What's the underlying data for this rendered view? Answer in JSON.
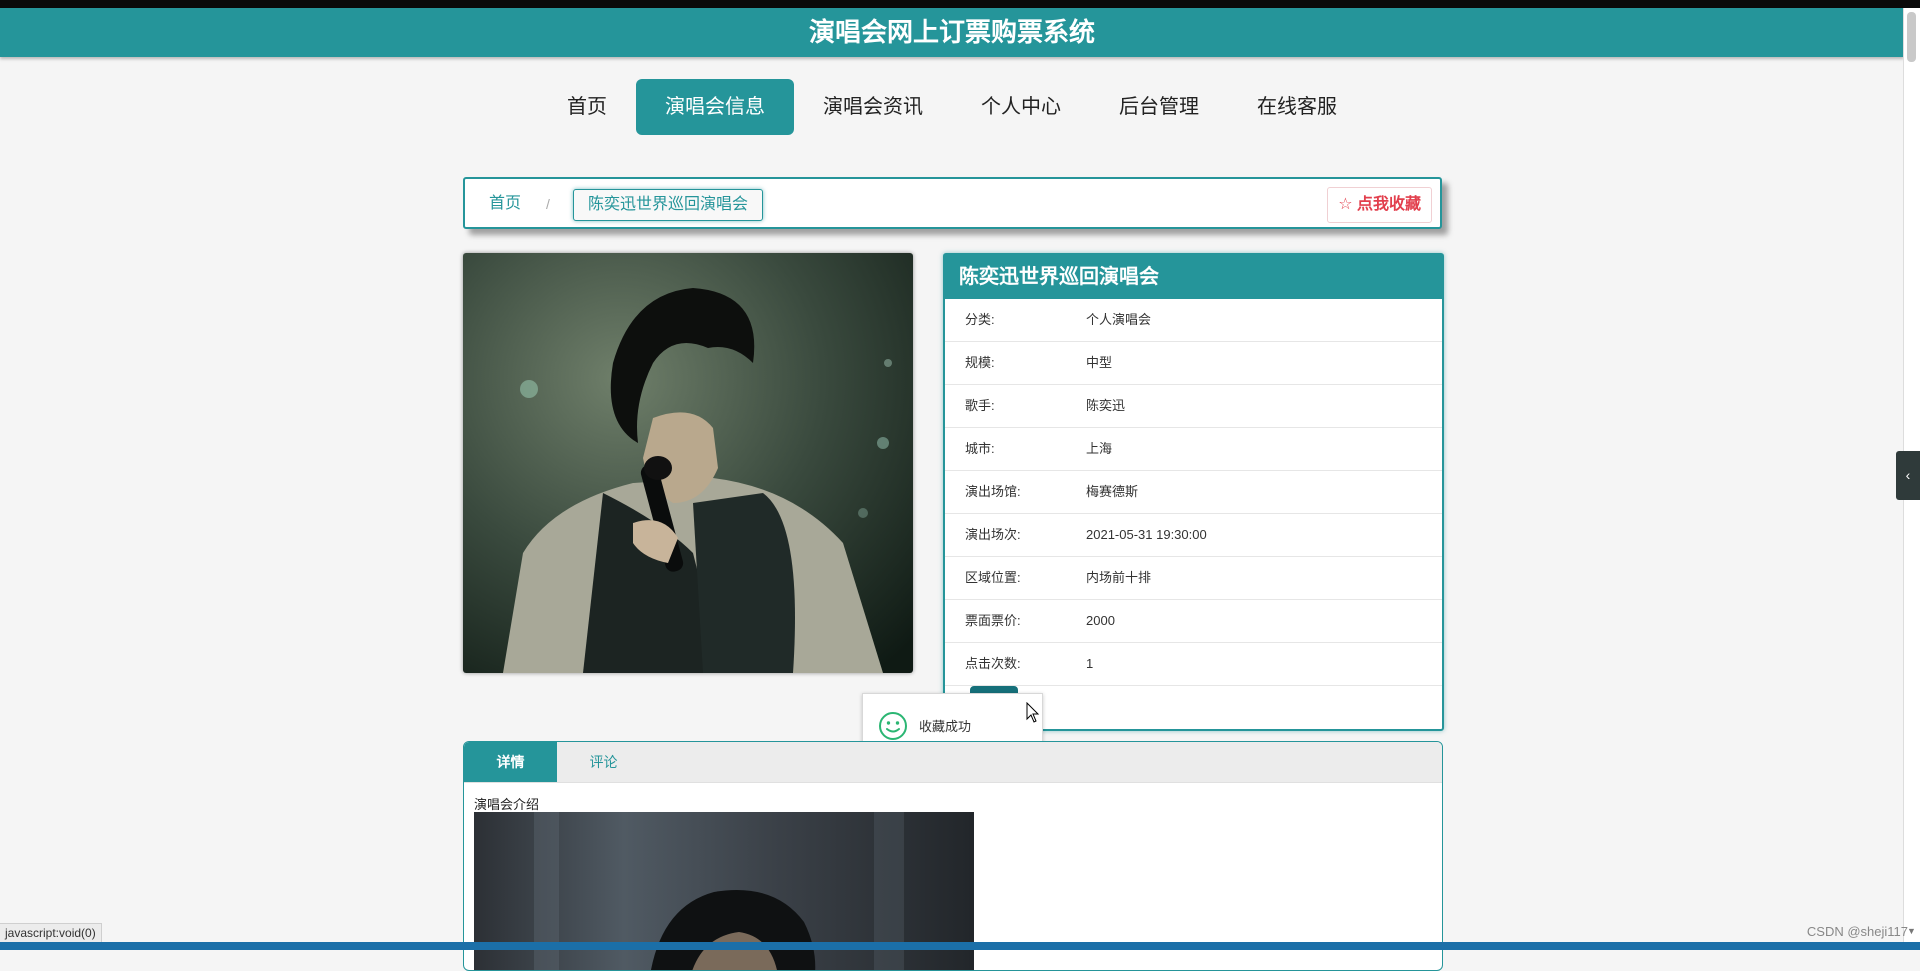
{
  "header": {
    "title": "演唱会网上订票购票系统"
  },
  "nav": [
    {
      "label": "首页"
    },
    {
      "label": "演唱会信息"
    },
    {
      "label": "演唱会资讯"
    },
    {
      "label": "个人中心"
    },
    {
      "label": "后台管理"
    },
    {
      "label": "在线客服"
    }
  ],
  "nav_active_index": 1,
  "breadcrumb": {
    "home": "首页",
    "separator": "/",
    "current": "陈奕迅世界巡回演唱会",
    "favorite_label": "☆ 点我收藏"
  },
  "detail": {
    "title": "陈奕迅世界巡回演唱会",
    "rows": [
      {
        "label": "分类:",
        "value": "个人演唱会"
      },
      {
        "label": "规模:",
        "value": "中型"
      },
      {
        "label": "歌手:",
        "value": "陈奕迅"
      },
      {
        "label": "城市:",
        "value": "上海"
      },
      {
        "label": "演出场馆:",
        "value": "梅赛德斯"
      },
      {
        "label": "演出场次:",
        "value": "2021-05-31 19:30:00"
      },
      {
        "label": "区域位置:",
        "value": "内场前十排"
      },
      {
        "label": "票面票价:",
        "value": "2000"
      },
      {
        "label": "点击次数:",
        "value": "1"
      }
    ]
  },
  "toast": {
    "message": "收藏成功",
    "icon": "smile-icon"
  },
  "tabs": [
    {
      "label": "详情"
    },
    {
      "label": "评论"
    }
  ],
  "intro_label": "演唱会介绍",
  "statusbar": "javascript:void(0)",
  "watermark": "CSDN @sheji117",
  "colors": {
    "primary": "#25959a",
    "favorite": "#e23f4d"
  }
}
